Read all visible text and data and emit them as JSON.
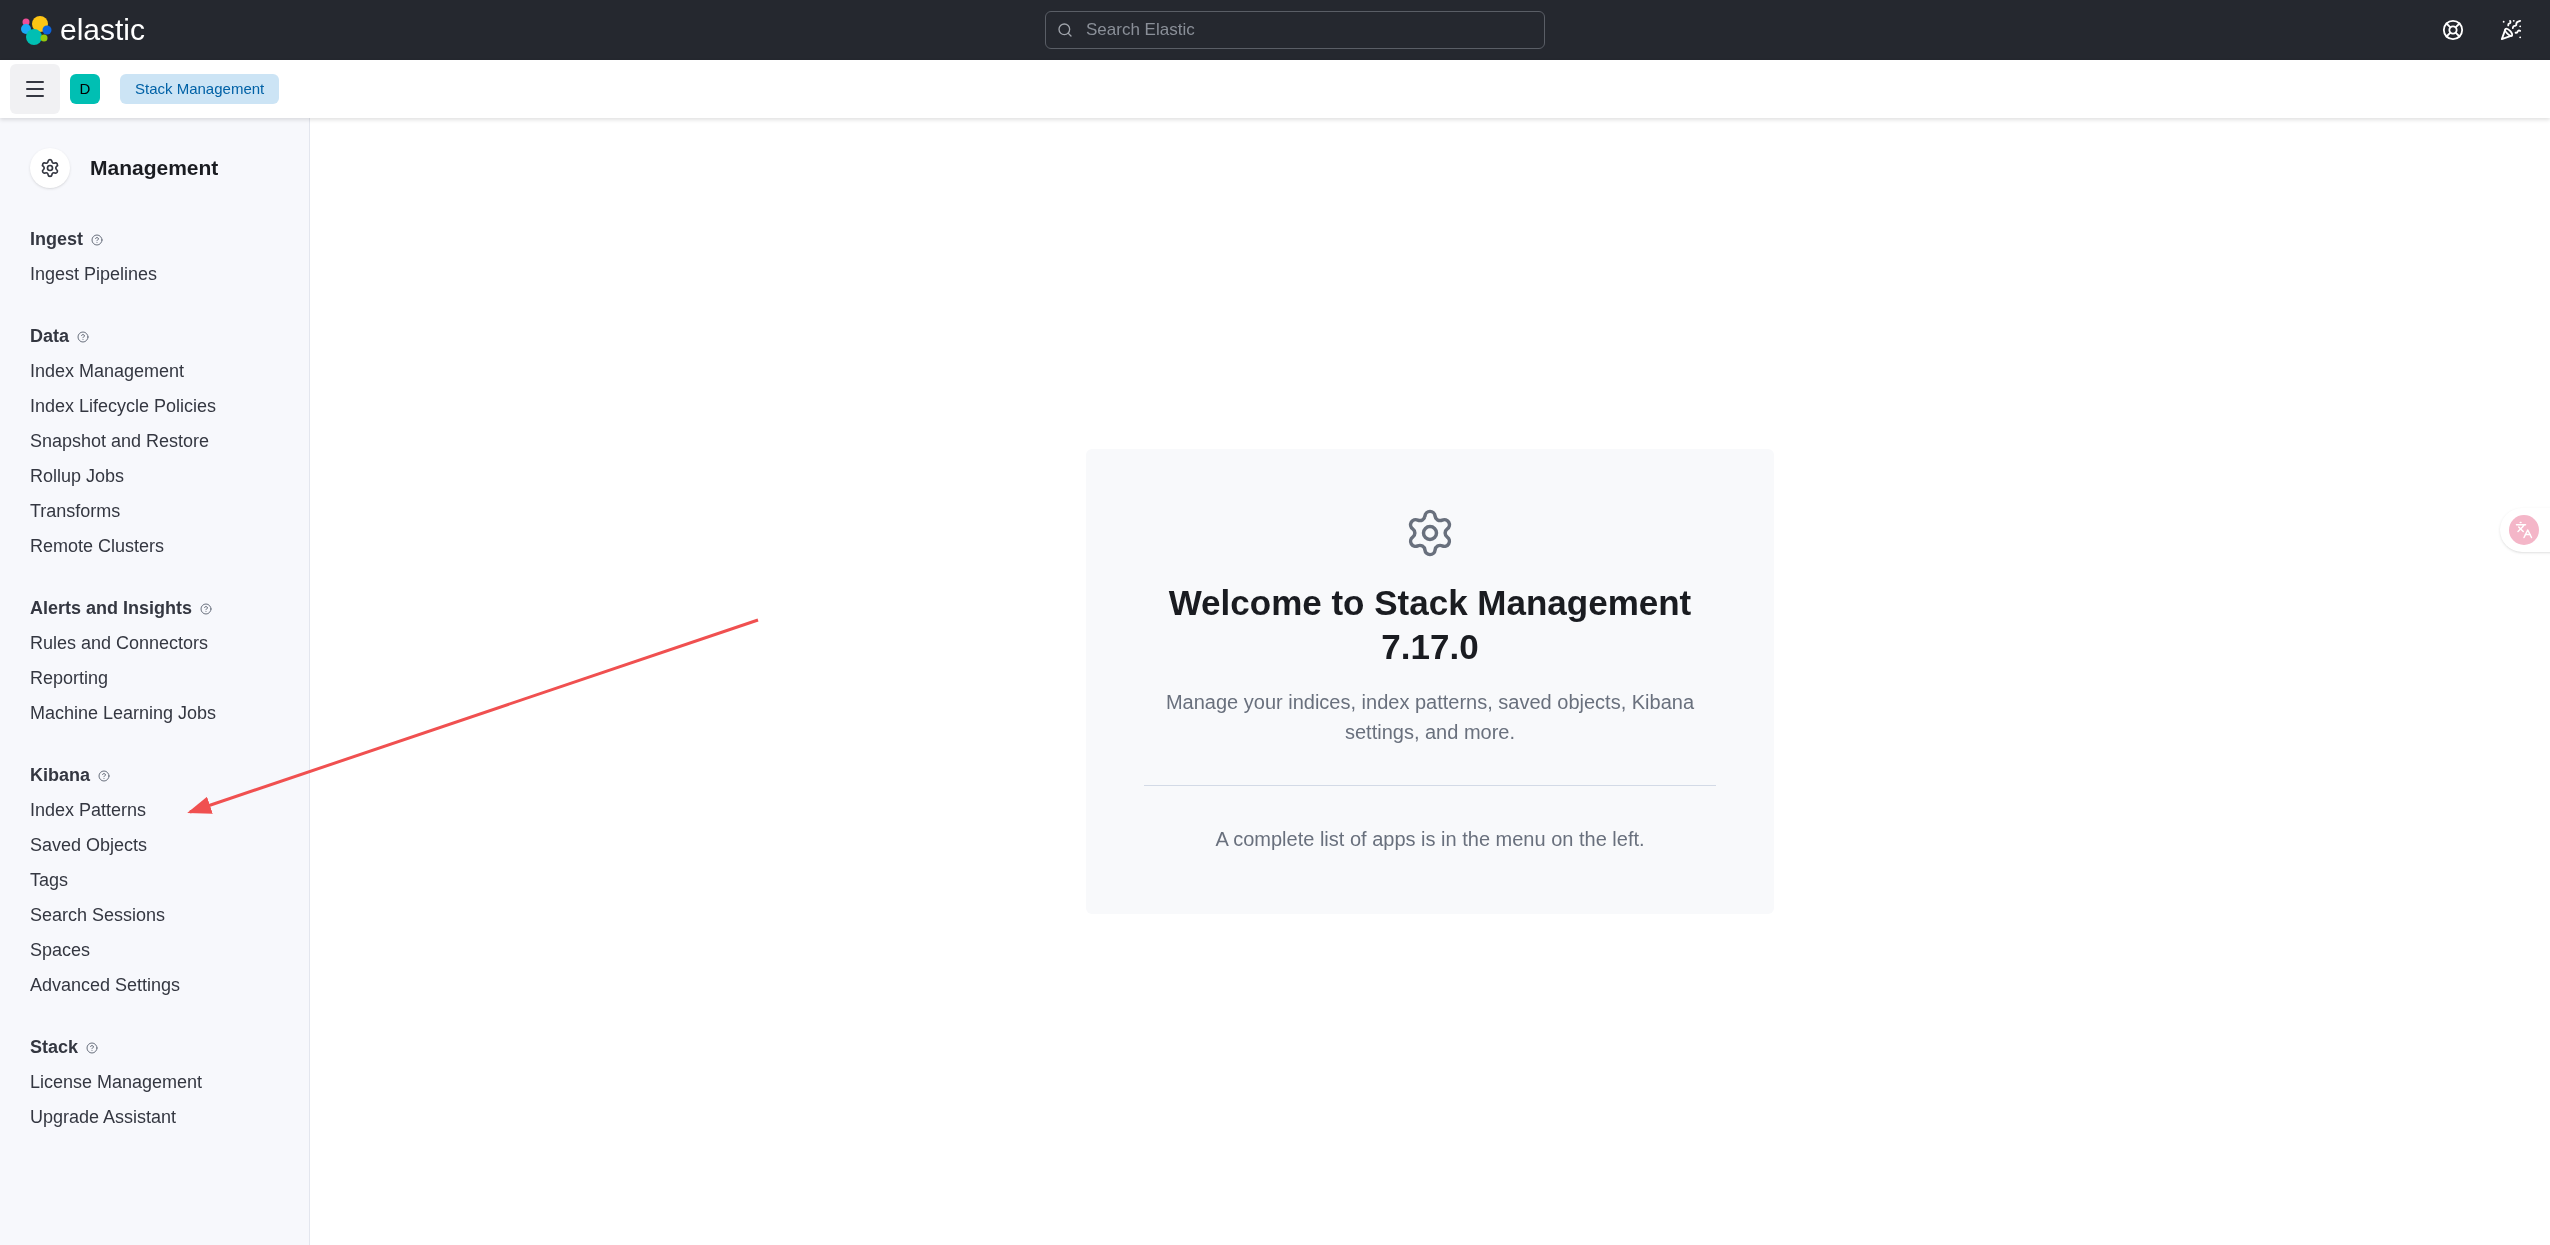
{
  "header": {
    "logo_text": "elastic",
    "search": {
      "placeholder": "Search Elastic"
    }
  },
  "breadcrumbs": {
    "space_initial": "D",
    "items": [
      "Stack Management"
    ]
  },
  "sidebar": {
    "title": "Management",
    "sections": [
      {
        "heading": "Ingest",
        "items": [
          "Ingest Pipelines"
        ]
      },
      {
        "heading": "Data",
        "items": [
          "Index Management",
          "Index Lifecycle Policies",
          "Snapshot and Restore",
          "Rollup Jobs",
          "Transforms",
          "Remote Clusters"
        ]
      },
      {
        "heading": "Alerts and Insights",
        "items": [
          "Rules and Connectors",
          "Reporting",
          "Machine Learning Jobs"
        ]
      },
      {
        "heading": "Kibana",
        "items": [
          "Index Patterns",
          "Saved Objects",
          "Tags",
          "Search Sessions",
          "Spaces",
          "Advanced Settings"
        ]
      },
      {
        "heading": "Stack",
        "items": [
          "License Management",
          "Upgrade Assistant"
        ]
      }
    ]
  },
  "welcome": {
    "title": "Welcome to Stack Management 7.17.0",
    "description": "Manage your indices, index patterns, saved objects, Kibana settings, and more.",
    "hint": "A complete list of apps is in the menu on the left."
  }
}
